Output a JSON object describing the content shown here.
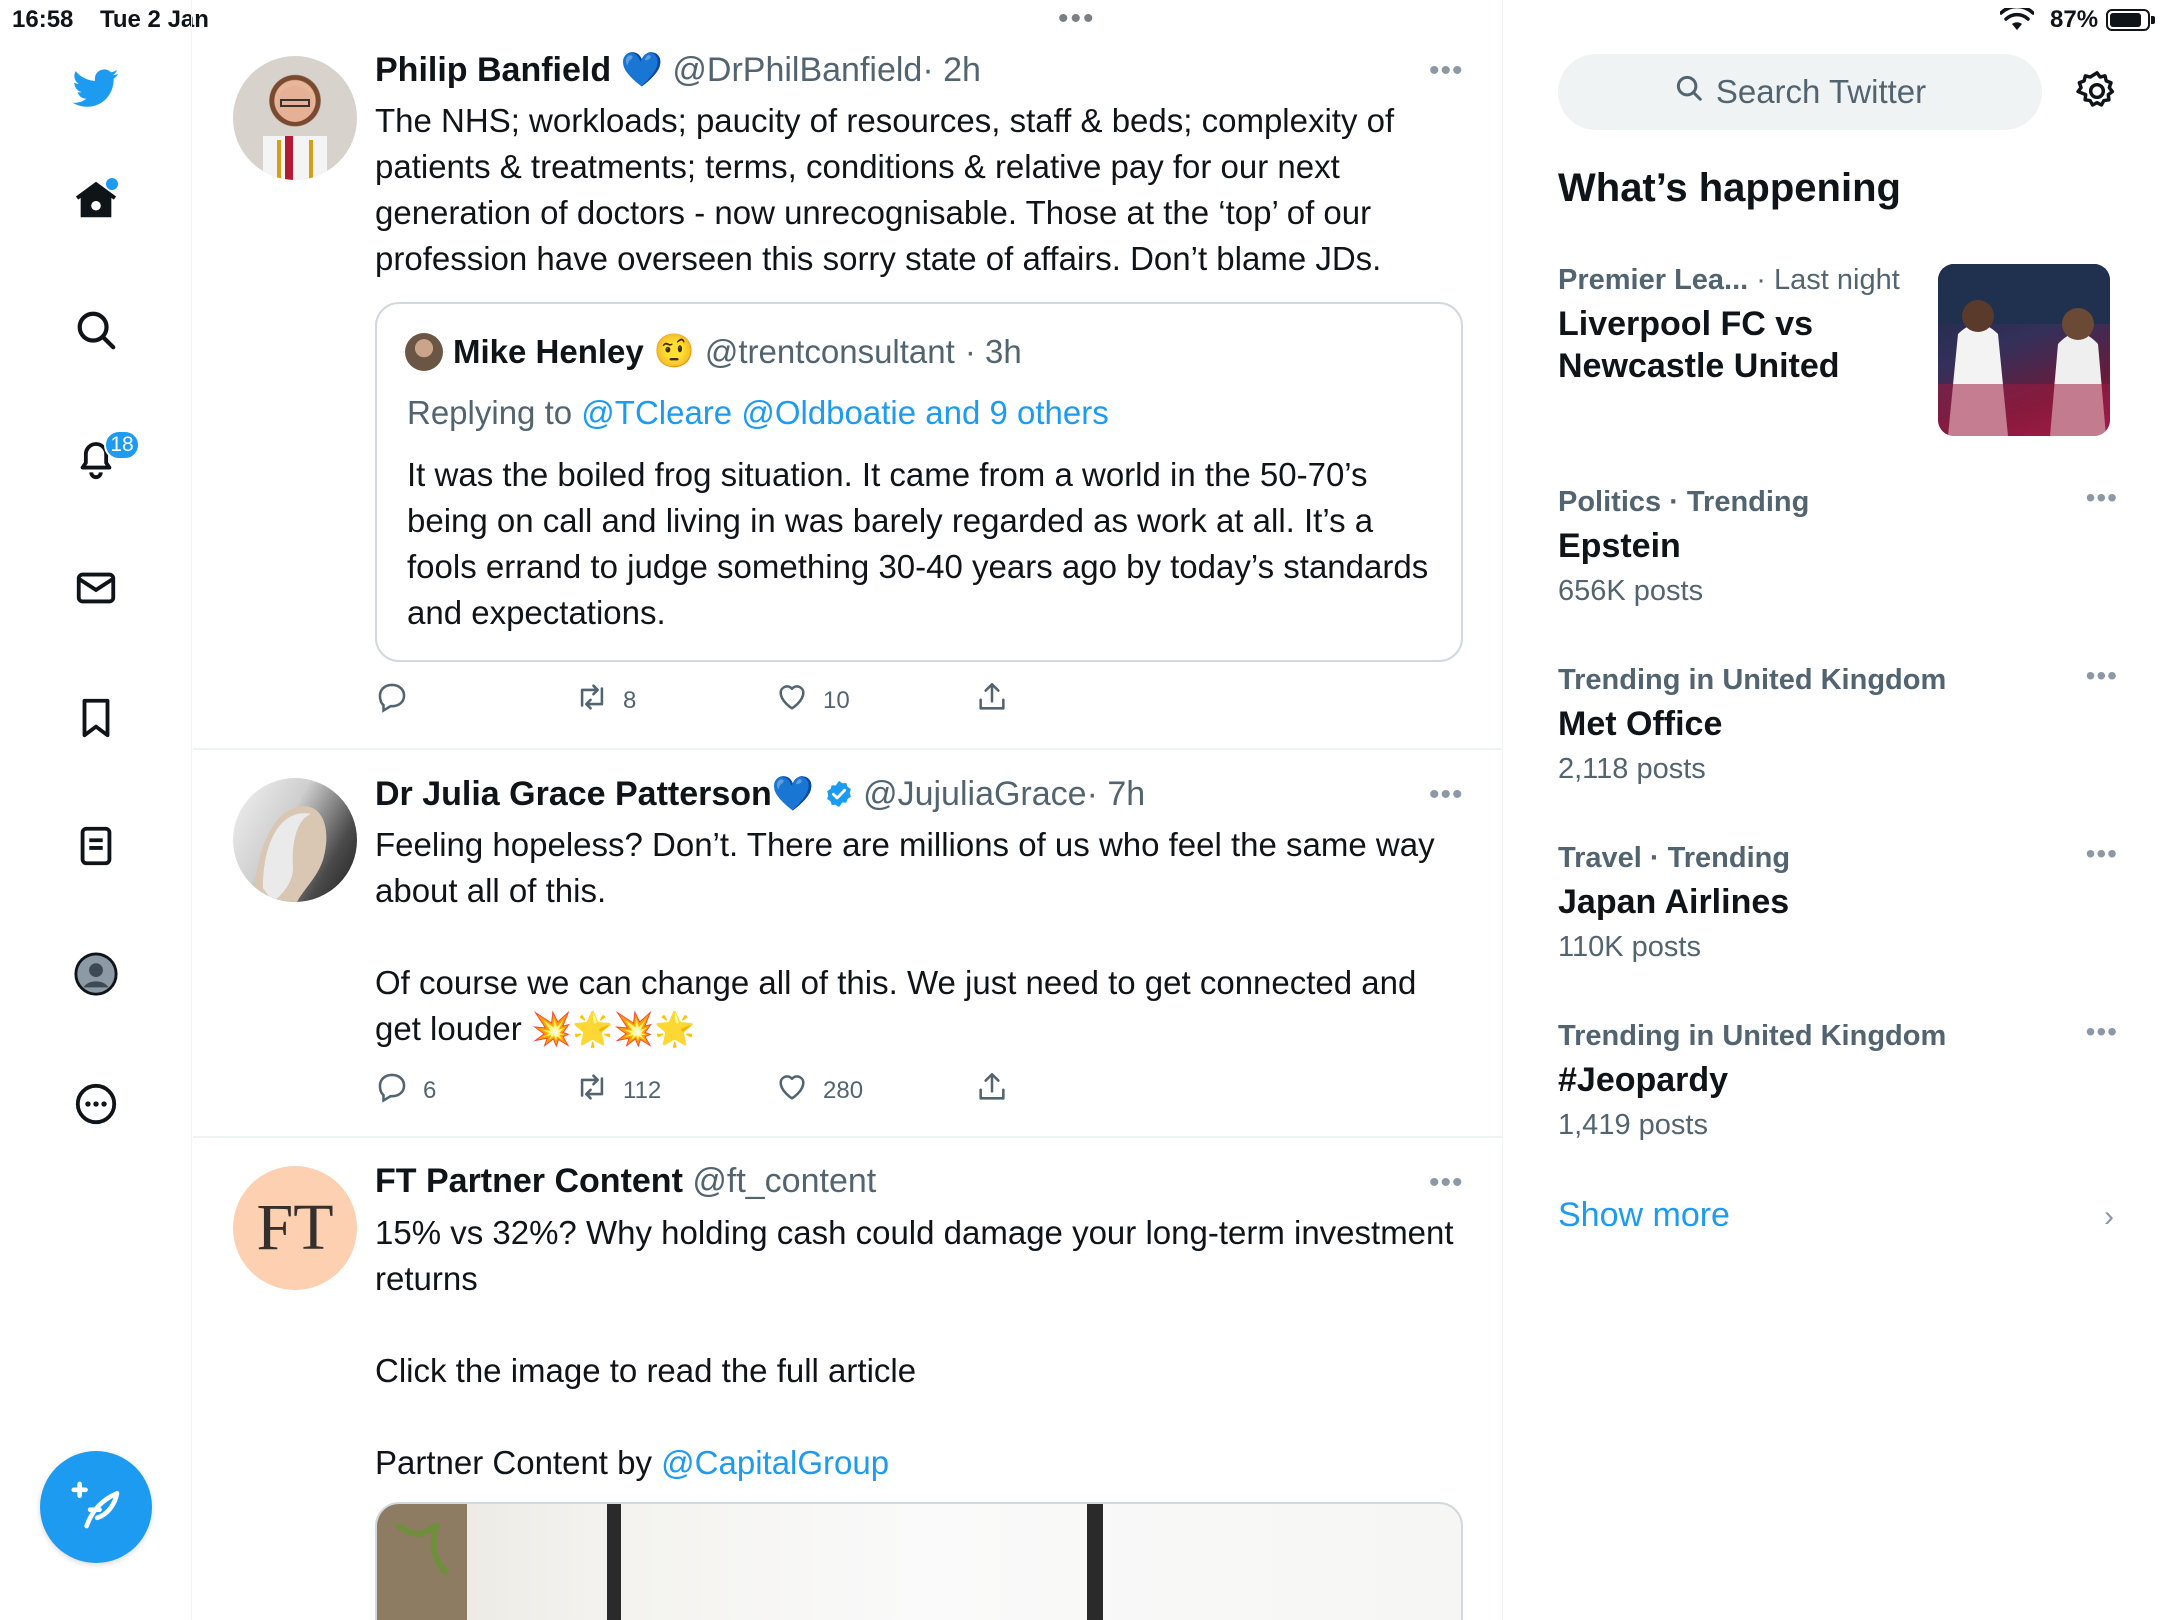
{
  "status_bar": {
    "time": "16:58",
    "date": "Tue 2 Jan",
    "battery": "87%",
    "battery_level": 0.87
  },
  "nav": {
    "notifications_count": "18",
    "accent": "#1d9bf0"
  },
  "tweets": [
    {
      "name": "Philip Banfield",
      "badge": "💙",
      "handle": "@DrPhilBanfield",
      "time": "· 2h",
      "text": "The NHS; workloads; paucity of resources, staff & beds; complexity of patients & treatments; terms, conditions & relative pay for our next generation of doctors - now unrecognisable. Those at the ‘top’ of our profession have overseen this sorry state of affairs. Don’t blame JDs.",
      "quote": {
        "name": "Mike Henley",
        "emoji": "🤨",
        "handle": "@trentconsultant",
        "time": "· 3h",
        "reply_prefix": "Replying to",
        "reply_targets": "@TCleare @Oldboatie and 9 others",
        "text": "It was the boiled frog situation. It came from a world in the 50-70’s being on call and living in was barely regarded as work at all. It’s a fools errand to judge something 30-40 years ago by today’s standards and expectations."
      },
      "replies": "",
      "retweets": "8",
      "likes": "10"
    },
    {
      "name": "Dr Julia Grace Patterson",
      "badge": "💙",
      "handle": "@JujuliaGrace",
      "time": "· 7h",
      "text": "Feeling hopeless? Don’t. There are millions of us who feel the same way about all of this.\n\nOf course we can change all of this. We just need to get connected and get louder 💥🌟💥🌟",
      "replies": "6",
      "retweets": "112",
      "likes": "280"
    },
    {
      "name": "FT Partner Content",
      "handle": "@ft_content",
      "avatar_text": "FT",
      "text_1": "15% vs 32%? Why holding cash could damage your long-term investment returns\n\nClick the image to read the full article\n\nPartner Content by ",
      "text_link": "@CapitalGroup"
    }
  ],
  "sidebar": {
    "search_placeholder": "Search Twitter",
    "heading": "What’s happening",
    "trends": [
      {
        "meta": "Premier Lea...",
        "meta_time": "· Last night",
        "title": "Liverpool FC vs Newcastle United",
        "count": ""
      },
      {
        "meta": "Politics · Trending",
        "title": "Epstein",
        "count": "656K posts"
      },
      {
        "meta": "Trending in United Kingdom",
        "title": "Met Office",
        "count": "2,118 posts"
      },
      {
        "meta": "Travel · Trending",
        "title": "Japan Airlines",
        "count": "110K posts"
      },
      {
        "meta": "Trending in United Kingdom",
        "title": "#Jeopardy",
        "count": "1,419 posts"
      }
    ],
    "show_more": "Show more"
  }
}
